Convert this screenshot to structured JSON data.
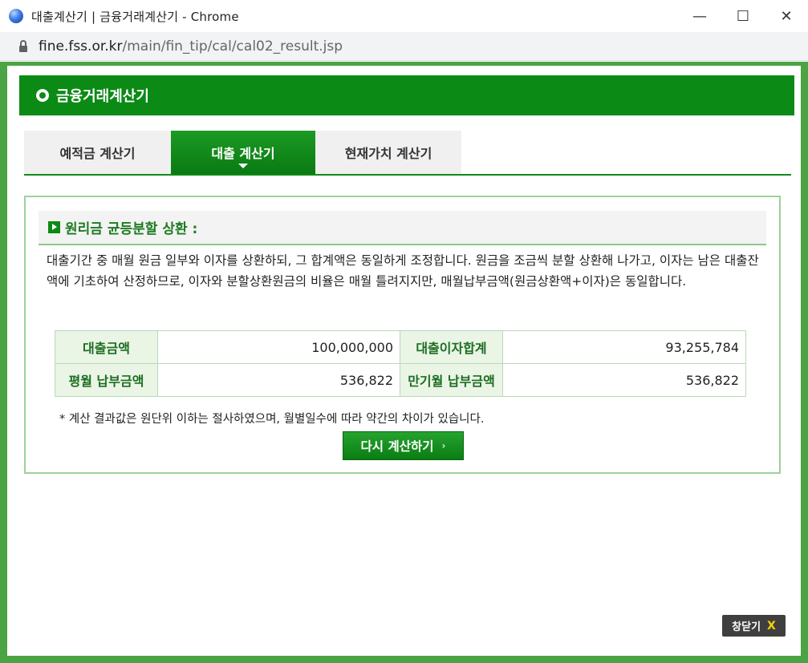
{
  "window": {
    "title": "대출계산기 | 금융거래계산기 - Chrome",
    "minimize_glyph": "—",
    "maximize_glyph": "☐",
    "close_glyph": "✕"
  },
  "address": {
    "host": "fine.fss.or.kr",
    "path": "/main/fin_tip/cal/cal02_result.jsp"
  },
  "header": {
    "title": "금융거래계산기"
  },
  "tabs": [
    {
      "label": "예적금 계산기"
    },
    {
      "label": "대출 계산기"
    },
    {
      "label": "현재가치 계산기"
    }
  ],
  "section": {
    "title": "원리금 균등분할 상환 :",
    "description": "대출기간 중 매월 원금 일부와 이자를 상환하되, 그 합계액은 동일하게 조정합니다. 원금을 조금씩 분할 상환해 나가고, 이자는 남은 대출잔액에 기초하여 산정하므로, 이자와 분할상환원금의 비율은 매월 틀려지지만, 매월납부금액(원금상환액+이자)은 동일합니다."
  },
  "results": {
    "loan_amount_label": "대출금액",
    "loan_amount": "100,000,000",
    "total_interest_label": "대출이자합계",
    "total_interest": "93,255,784",
    "monthly_payment_label": "평월 납부금액",
    "monthly_payment": "536,822",
    "final_payment_label": "만기월 납부금액",
    "final_payment": "536,822"
  },
  "note": "* 계산 결과값은 원단위 이하는 절사하였으며, 월별일수에 따라 약간의 차이가 있습니다.",
  "buttons": {
    "recalculate": "다시 계산하기",
    "recalculate_arrow": "›",
    "close": "창닫기",
    "close_x": "X"
  }
}
